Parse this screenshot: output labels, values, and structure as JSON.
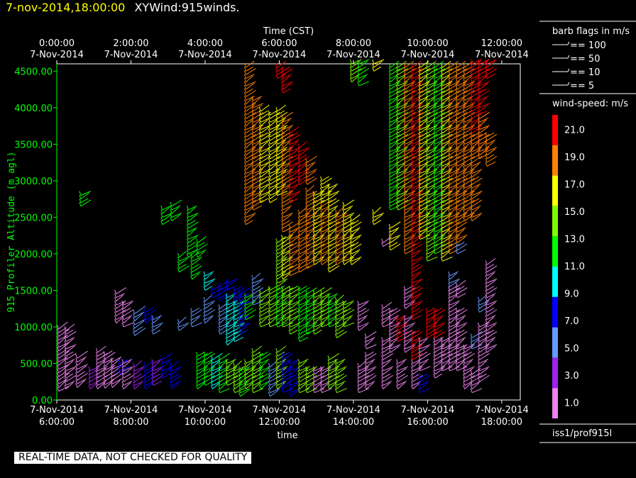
{
  "header": {
    "date_time": "7-nov-2014,18:00:00",
    "product": "XYWind:915winds."
  },
  "chart_data": {
    "type": "wind-barb",
    "top_axis": {
      "title": "Time (CST)",
      "ticks": [
        {
          "time": "0:00:00",
          "date": "7-Nov-2014"
        },
        {
          "time": "2:00:00",
          "date": "7-Nov-2014"
        },
        {
          "time": "4:00:00",
          "date": "7-Nov-2014"
        },
        {
          "time": "6:00:00",
          "date": "7-Nov-2014"
        },
        {
          "time": "8:00:00",
          "date": "7-Nov-2014"
        },
        {
          "time": "10:00:00",
          "date": "7-Nov-2014"
        },
        {
          "time": "12:00:00",
          "date": "7-Nov-2014"
        }
      ]
    },
    "bottom_axis": {
      "title": "time",
      "ticks": [
        {
          "date": "7-Nov-2014",
          "time": "6:00:00"
        },
        {
          "date": "7-Nov-2014",
          "time": "8:00:00"
        },
        {
          "date": "7-Nov-2014",
          "time": "10:00:00"
        },
        {
          "date": "7-Nov-2014",
          "time": "12:00:00"
        },
        {
          "date": "7-Nov-2014",
          "time": "14:00:00"
        },
        {
          "date": "7-Nov-2014",
          "time": "16:00:00"
        },
        {
          "date": "7-Nov-2014",
          "time": "18:00:00"
        }
      ],
      "range_hours": [
        6,
        18.5
      ]
    },
    "y_axis": {
      "label": "915 Profiler Altitude (m agl)",
      "ticks": [
        "0.00",
        "500.00",
        "1000.00",
        "1500.00",
        "2000.00",
        "2500.00",
        "3000.00",
        "3500.00",
        "4000.00",
        "4500.00"
      ],
      "range": [
        0,
        4600
      ]
    },
    "barb_legend": {
      "title": "barb flags in m/s",
      "items": [
        "== 100",
        "== 50",
        "== 10",
        "== 5"
      ]
    },
    "speed_scale": {
      "title": "wind-speed: m/s",
      "labels": [
        "21.0",
        "19.0",
        "17.0",
        "15.0",
        "13.0",
        "11.0",
        "9.0",
        "7.0",
        "5.0",
        "3.0",
        "1.0"
      ],
      "colors": [
        "#ff0000",
        "#ff8000",
        "#ffff00",
        "#80ff00",
        "#00ff00",
        "#00ffff",
        "#0000ff",
        "#6699ff",
        "#a020f0",
        "#ee82ee"
      ]
    },
    "axis_color": "#00ff00",
    "columns": [
      {
        "hour": 6.05,
        "segments": [
          [
            120,
            980,
            2
          ]
        ]
      },
      {
        "hour": 6.25,
        "segments": [
          [
            150,
            950,
            2
          ]
        ]
      },
      {
        "hour": 6.55,
        "segments": [
          [
            170,
            590,
            4
          ]
        ]
      },
      {
        "hour": 6.65,
        "segments": [
          [
            2650,
            2800,
            13
          ]
        ]
      },
      {
        "hour": 6.9,
        "segments": [
          [
            150,
            420,
            5
          ]
        ]
      },
      {
        "hour": 7.1,
        "segments": [
          [
            150,
            650,
            3
          ]
        ]
      },
      {
        "hour": 7.3,
        "segments": [
          [
            160,
            610,
            4
          ]
        ]
      },
      {
        "hour": 7.5,
        "segments": [
          [
            170,
            530,
            3
          ]
        ]
      },
      {
        "hour": 7.6,
        "segments": [
          [
            1050,
            1470,
            3
          ]
        ]
      },
      {
        "hour": 7.7,
        "segments": [
          [
            350,
            520,
            9
          ]
        ]
      },
      {
        "hour": 7.8,
        "segments": [
          [
            150,
            500,
            4
          ],
          [
            1000,
            1300,
            3
          ]
        ]
      },
      {
        "hour": 8.1,
        "segments": [
          [
            150,
            450,
            6
          ],
          [
            880,
            1200,
            7
          ]
        ]
      },
      {
        "hour": 8.4,
        "segments": [
          [
            150,
            450,
            9
          ],
          [
            1050,
            1200,
            9
          ]
        ]
      },
      {
        "hour": 8.6,
        "segments": [
          [
            200,
            500,
            6
          ],
          [
            900,
            1100,
            7
          ]
        ]
      },
      {
        "hour": 8.85,
        "segments": [
          [
            300,
            550,
            9
          ],
          [
            2400,
            2600,
            13
          ]
        ]
      },
      {
        "hour": 9.1,
        "segments": [
          [
            150,
            450,
            9
          ],
          [
            2450,
            2650,
            13
          ]
        ]
      },
      {
        "hour": 9.3,
        "segments": [
          [
            950,
            1050,
            7
          ],
          [
            1750,
            1950,
            13
          ]
        ]
      },
      {
        "hour": 9.55,
        "segments": [
          [
            1950,
            2600,
            13
          ]
        ]
      },
      {
        "hour": 9.65,
        "segments": [
          [
            1000,
            1200,
            7
          ],
          [
            1650,
            1950,
            13
          ]
        ]
      },
      {
        "hour": 9.8,
        "segments": [
          [
            150,
            600,
            13
          ],
          [
            1950,
            2150,
            13
          ]
        ]
      },
      {
        "hour": 10.0,
        "segments": [
          [
            200,
            600,
            13
          ],
          [
            1050,
            1350,
            7
          ],
          [
            1500,
            1700,
            11
          ]
        ]
      },
      {
        "hour": 10.2,
        "segments": [
          [
            150,
            550,
            11
          ],
          [
            1400,
            1500,
            9
          ]
        ]
      },
      {
        "hour": 10.4,
        "segments": [
          [
            100,
            550,
            13
          ],
          [
            900,
            1250,
            7
          ],
          [
            1350,
            1550,
            9
          ]
        ]
      },
      {
        "hour": 10.6,
        "segments": [
          [
            200,
            500,
            15
          ],
          [
            750,
            1400,
            11
          ],
          [
            1500,
            1600,
            9
          ]
        ]
      },
      {
        "hour": 10.8,
        "segments": [
          [
            100,
            450,
            15
          ],
          [
            800,
            1300,
            11
          ],
          [
            1350,
            1500,
            9
          ]
        ]
      },
      {
        "hour": 10.95,
        "segments": [
          [
            50,
            400,
            13
          ],
          [
            900,
            1450,
            9
          ]
        ]
      },
      {
        "hour": 11.1,
        "segments": [
          [
            150,
            520,
            15
          ],
          [
            1100,
            1430,
            13
          ],
          [
            2400,
            4550,
            19
          ]
        ]
      },
      {
        "hour": 11.3,
        "segments": [
          [
            100,
            650,
            15
          ],
          [
            1300,
            1650,
            7
          ],
          [
            2600,
            4100,
            19
          ]
        ]
      },
      {
        "hour": 11.5,
        "segments": [
          [
            150,
            600,
            13
          ],
          [
            1000,
            1450,
            15
          ],
          [
            2700,
            3950,
            17
          ]
        ]
      },
      {
        "hour": 11.75,
        "segments": [
          [
            50,
            450,
            7
          ],
          [
            1000,
            1500,
            15
          ],
          [
            2700,
            3900,
            17
          ]
        ]
      },
      {
        "hour": 11.95,
        "segments": [
          [
            150,
            650,
            15
          ],
          [
            1000,
            1500,
            13
          ],
          [
            1550,
            2150,
            15
          ],
          [
            2800,
            3950,
            17
          ],
          [
            4400,
            4550,
            21
          ]
        ]
      },
      {
        "hour": 12.1,
        "segments": [
          [
            100,
            600,
            9
          ],
          [
            1000,
            1500,
            15
          ],
          [
            1650,
            2200,
            17
          ],
          [
            2300,
            3850,
            19
          ],
          [
            4200,
            4500,
            21
          ]
        ]
      },
      {
        "hour": 12.3,
        "segments": [
          [
            50,
            500,
            9
          ],
          [
            900,
            1500,
            15
          ],
          [
            1700,
            2350,
            19
          ],
          [
            2700,
            3650,
            21
          ]
        ]
      },
      {
        "hour": 12.55,
        "segments": [
          [
            100,
            500,
            15
          ],
          [
            800,
            1500,
            13
          ],
          [
            1750,
            2550,
            19
          ],
          [
            2950,
            3450,
            21
          ]
        ]
      },
      {
        "hour": 12.75,
        "segments": [
          [
            100,
            400,
            15
          ],
          [
            900,
            1450,
            13
          ],
          [
            1800,
            2850,
            19
          ],
          [
            2950,
            3250,
            19
          ]
        ]
      },
      {
        "hour": 12.95,
        "segments": [
          [
            100,
            400,
            3
          ],
          [
            900,
            1450,
            15
          ],
          [
            1850,
            2800,
            17
          ]
        ]
      },
      {
        "hour": 13.15,
        "segments": [
          [
            100,
            400,
            3
          ],
          [
            1000,
            1450,
            15
          ],
          [
            1850,
            2650,
            19
          ],
          [
            2700,
            3000,
            17
          ]
        ]
      },
      {
        "hour": 13.35,
        "segments": [
          [
            150,
            550,
            15
          ],
          [
            1000,
            1400,
            13
          ],
          [
            1750,
            2900,
            17
          ]
        ]
      },
      {
        "hour": 13.55,
        "segments": [
          [
            100,
            500,
            15
          ],
          [
            850,
            1350,
            15
          ],
          [
            1850,
            2550,
            19
          ]
        ]
      },
      {
        "hour": 13.75,
        "segments": [
          [
            1000,
            1300,
            15
          ],
          [
            1850,
            2650,
            17
          ]
        ]
      },
      {
        "hour": 13.95,
        "segments": [
          [
            1850,
            2450,
            17
          ],
          [
            4350,
            4600,
            15
          ]
        ]
      },
      {
        "hour": 14.15,
        "segments": [
          [
            100,
            450,
            3
          ],
          [
            950,
            1300,
            3
          ],
          [
            4300,
            4600,
            13
          ]
        ]
      },
      {
        "hour": 14.35,
        "segments": [
          [
            150,
            600,
            3
          ],
          [
            700,
            850,
            3
          ]
        ]
      },
      {
        "hour": 14.55,
        "segments": [
          [
            2400,
            2550,
            17
          ],
          [
            4500,
            4600,
            17
          ]
        ]
      },
      {
        "hour": 14.8,
        "segments": [
          [
            150,
            800,
            3
          ],
          [
            1000,
            1250,
            3
          ],
          [
            2100,
            2150,
            3
          ]
        ]
      },
      {
        "hour": 15.0,
        "segments": [
          [
            2600,
            4550,
            13
          ],
          [
            2050,
            2350,
            17
          ],
          [
            650,
            1200,
            3
          ]
        ]
      },
      {
        "hour": 15.2,
        "segments": [
          [
            2600,
            4550,
            15
          ],
          [
            800,
            1100,
            21
          ],
          [
            150,
            500,
            3
          ]
        ]
      },
      {
        "hour": 15.4,
        "segments": [
          [
            2000,
            4550,
            19
          ],
          [
            1250,
            1500,
            3
          ],
          [
            650,
            1100,
            3
          ]
        ]
      },
      {
        "hour": 15.6,
        "segments": [
          [
            1400,
            4550,
            21
          ],
          [
            1100,
            1400,
            21
          ],
          [
            550,
            900,
            21
          ],
          [
            150,
            500,
            3
          ]
        ]
      },
      {
        "hour": 15.8,
        "segments": [
          [
            2200,
            4550,
            17
          ],
          [
            400,
            800,
            3
          ],
          [
            100,
            300,
            9
          ]
        ]
      },
      {
        "hour": 16.0,
        "segments": [
          [
            1900,
            4550,
            15
          ],
          [
            850,
            1200,
            21
          ]
        ]
      },
      {
        "hour": 16.2,
        "segments": [
          [
            2000,
            4550,
            13
          ],
          [
            850,
            1200,
            21
          ],
          [
            300,
            800,
            3
          ]
        ]
      },
      {
        "hour": 16.4,
        "segments": [
          [
            1900,
            4550,
            17
          ],
          [
            400,
            800,
            3
          ]
        ]
      },
      {
        "hour": 16.6,
        "segments": [
          [
            2000,
            4550,
            19
          ],
          [
            1450,
            1700,
            7
          ],
          [
            400,
            1500,
            3
          ]
        ]
      },
      {
        "hour": 16.8,
        "segments": [
          [
            2150,
            4550,
            19
          ],
          [
            2000,
            2100,
            7
          ],
          [
            1400,
            1550,
            3
          ],
          [
            400,
            1200,
            3
          ]
        ]
      },
      {
        "hour": 17.0,
        "segments": [
          [
            2450,
            4550,
            19
          ],
          [
            150,
            700,
            3
          ]
        ]
      },
      {
        "hour": 17.2,
        "segments": [
          [
            3450,
            4600,
            21
          ],
          [
            2450,
            3600,
            19
          ],
          [
            700,
            850,
            7
          ],
          [
            100,
            350,
            3
          ]
        ]
      },
      {
        "hour": 17.4,
        "segments": [
          [
            3350,
            4600,
            21
          ],
          [
            3300,
            3850,
            19
          ],
          [
            1200,
            1350,
            7
          ],
          [
            250,
            1000,
            3
          ]
        ]
      },
      {
        "hour": 17.6,
        "segments": [
          [
            4400,
            4600,
            21
          ],
          [
            3200,
            3600,
            19
          ],
          [
            650,
            1850,
            3
          ]
        ]
      }
    ]
  },
  "footer": {
    "station": "iss1/prof915l",
    "qc_notice": "REAL-TIME DATA, NOT CHECKED FOR QUALITY"
  }
}
